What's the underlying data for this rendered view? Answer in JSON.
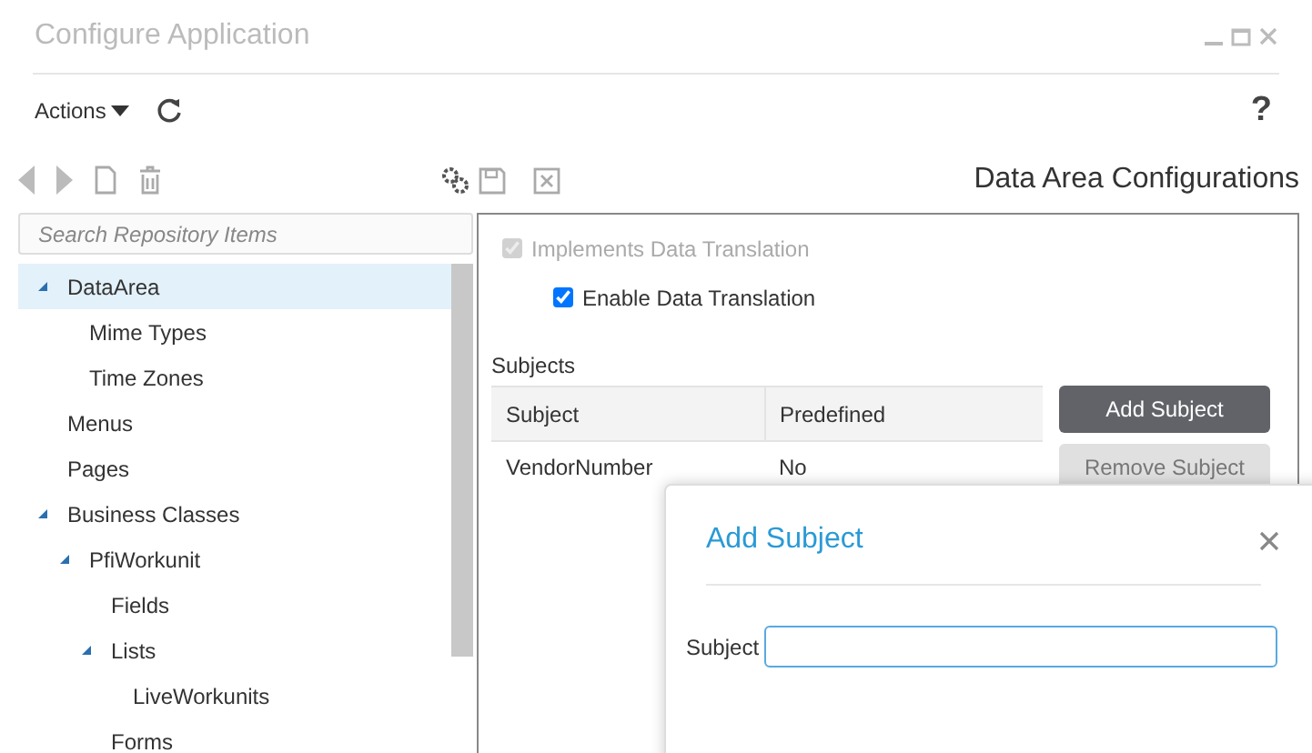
{
  "window": {
    "title": "Configure Application"
  },
  "toolbar": {
    "actions_label": "Actions",
    "help": "?"
  },
  "search": {
    "placeholder": "Search Repository Items"
  },
  "tree": [
    {
      "label": "DataArea",
      "expanded": true,
      "selected": true,
      "children": [
        {
          "label": "Mime Types",
          "selected": false
        },
        {
          "label": "Time Zones",
          "selected": false
        }
      ]
    },
    {
      "label": "Menus",
      "selected": false
    },
    {
      "label": "Pages",
      "selected": false
    },
    {
      "label": "Business Classes",
      "expanded": true,
      "selected": false,
      "children": [
        {
          "label": "PfiWorkunit",
          "expanded": true,
          "selected": false,
          "children": [
            {
              "label": "Fields",
              "selected": false
            },
            {
              "label": "Lists",
              "expanded": true,
              "selected": false,
              "children": [
                {
                  "label": "LiveWorkunits",
                  "selected": false
                }
              ]
            },
            {
              "label": "Forms",
              "selected": false
            }
          ]
        }
      ]
    }
  ],
  "panel": {
    "title": "Data Area Configurations",
    "checkboxes": [
      {
        "label": "Implements Data Translation",
        "checked": true,
        "disabled": true,
        "children": [
          {
            "label": "Enable Data Translation",
            "checked": true,
            "disabled": false
          }
        ]
      }
    ],
    "subjects_label": "Subjects",
    "table": {
      "columns": [
        "Subject",
        "Predefined"
      ],
      "rows": [
        [
          "VendorNumber",
          "No"
        ]
      ]
    },
    "buttons": [
      {
        "label": "Add Subject",
        "disabled": false
      },
      {
        "label": "Remove Subject",
        "disabled": true
      }
    ]
  },
  "dialog": {
    "title": "Add Subject",
    "field_label": "Subject"
  }
}
